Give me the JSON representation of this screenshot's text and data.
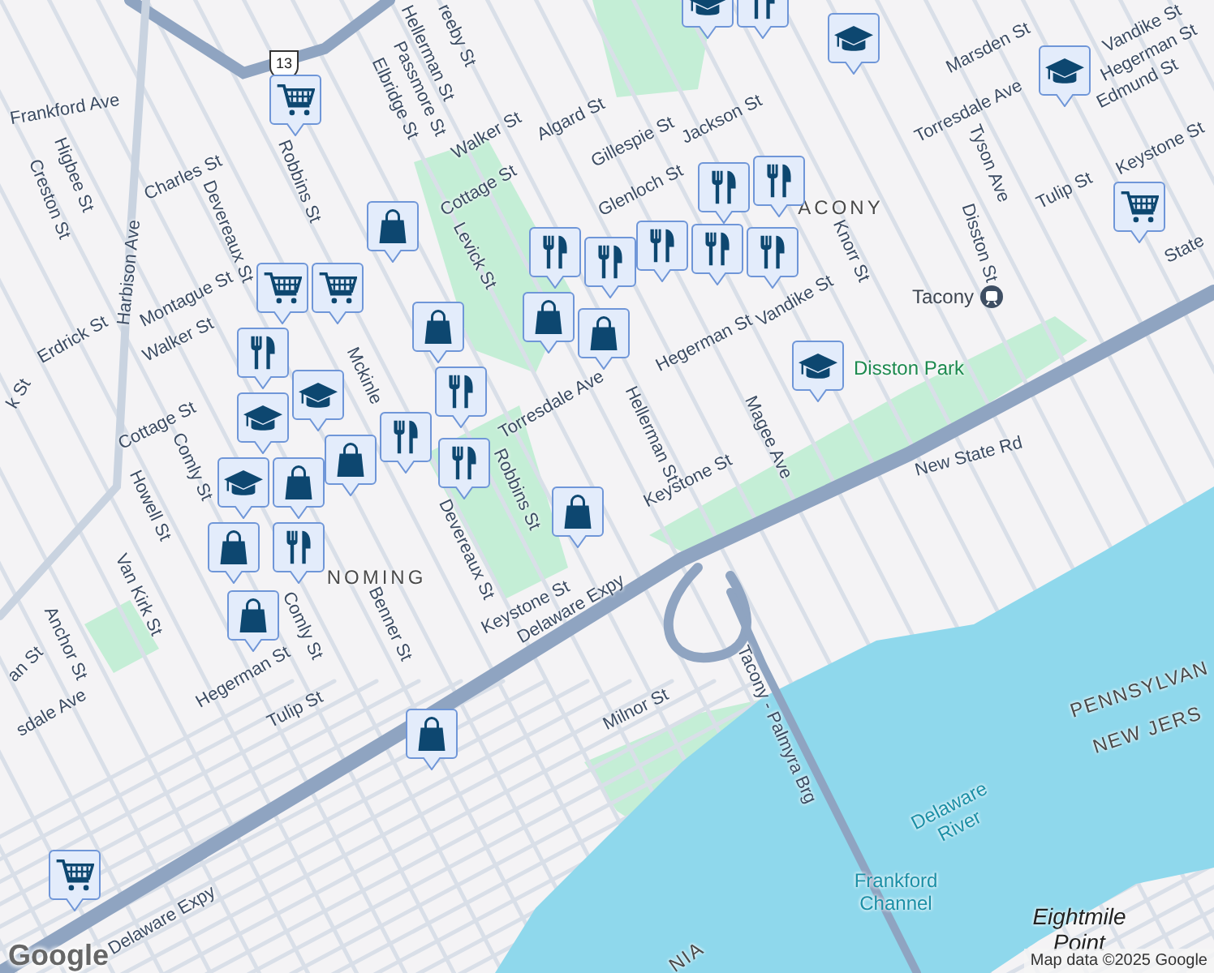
{
  "map": {
    "route_shield": "13",
    "labels": [
      {
        "text": "Frankford Ave",
        "kind": "street"
      },
      {
        "text": "Higbee St",
        "kind": "street"
      },
      {
        "text": "Creston St",
        "kind": "street"
      },
      {
        "text": "Charles St",
        "kind": "street"
      },
      {
        "text": "Harbison Ave",
        "kind": "street"
      },
      {
        "text": "Devereaux St",
        "kind": "street"
      },
      {
        "text": "Robbins St",
        "kind": "street"
      },
      {
        "text": "Erdrick St",
        "kind": "street"
      },
      {
        "text": "Montague St",
        "kind": "street"
      },
      {
        "text": "Walker St",
        "kind": "street"
      },
      {
        "text": "Cottage St",
        "kind": "street"
      },
      {
        "text": "Comly St",
        "kind": "street"
      },
      {
        "text": "Howell St",
        "kind": "street"
      },
      {
        "text": "Van Kirk St",
        "kind": "street"
      },
      {
        "text": "Anchor St",
        "kind": "street"
      },
      {
        "text": "Hegerman St",
        "kind": "street"
      },
      {
        "text": "Tulip St",
        "kind": "street"
      },
      {
        "text": "Comly St",
        "kind": "street"
      },
      {
        "text": "Benner St",
        "kind": "street"
      },
      {
        "text": "Devereaux St",
        "kind": "street"
      },
      {
        "text": "Keystone St",
        "kind": "street"
      },
      {
        "text": "Robbins St",
        "kind": "street"
      },
      {
        "text": "Delaware Expy",
        "kind": "street"
      },
      {
        "text": "Delaware Expy",
        "kind": "street"
      },
      {
        "text": "Milnor St",
        "kind": "street"
      },
      {
        "text": "Tacony - Palmyra Brg",
        "kind": "street"
      },
      {
        "text": "sdale Ave",
        "kind": "street"
      },
      {
        "text": "an St",
        "kind": "street"
      },
      {
        "text": "k St",
        "kind": "street"
      },
      {
        "text": "reeby St",
        "kind": "street"
      },
      {
        "text": "Hellerman St",
        "kind": "street"
      },
      {
        "text": "Passmore St",
        "kind": "street"
      },
      {
        "text": "Elbridge St",
        "kind": "street"
      },
      {
        "text": "Walker St",
        "kind": "street"
      },
      {
        "text": "Algard St",
        "kind": "street"
      },
      {
        "text": "Cottage St",
        "kind": "street"
      },
      {
        "text": "Levick St",
        "kind": "street"
      },
      {
        "text": "Mckinle",
        "kind": "street"
      },
      {
        "text": "Torresdale Ave",
        "kind": "street"
      },
      {
        "text": "Gillespie St",
        "kind": "street"
      },
      {
        "text": "Jackson St",
        "kind": "street"
      },
      {
        "text": "Glenloch St",
        "kind": "street"
      },
      {
        "text": "Vandike St",
        "kind": "street"
      },
      {
        "text": "Hegerman St",
        "kind": "street"
      },
      {
        "text": "Hellerman St",
        "kind": "street"
      },
      {
        "text": "Knorr St",
        "kind": "street"
      },
      {
        "text": "Magee Ave",
        "kind": "street"
      },
      {
        "text": "Keystone St",
        "kind": "street"
      },
      {
        "text": "Marsden St",
        "kind": "street"
      },
      {
        "text": "Torresdale Ave",
        "kind": "street"
      },
      {
        "text": "Tyson Ave",
        "kind": "street"
      },
      {
        "text": "Disston St",
        "kind": "street"
      },
      {
        "text": "Vandike St",
        "kind": "street"
      },
      {
        "text": "Hegerman St",
        "kind": "street"
      },
      {
        "text": "Edmund St",
        "kind": "street"
      },
      {
        "text": "Tulip St",
        "kind": "street"
      },
      {
        "text": "Keystone St",
        "kind": "street"
      },
      {
        "text": "New State Rd",
        "kind": "street"
      },
      {
        "text": "State",
        "kind": "street"
      },
      {
        "text": "ACONY",
        "kind": "area"
      },
      {
        "text": "NOMING",
        "kind": "area"
      },
      {
        "text": "Disston Park",
        "kind": "park"
      },
      {
        "text": "Delaware River",
        "kind": "water"
      },
      {
        "text": "Frankford Channel",
        "kind": "water"
      },
      {
        "text": "Eightmile Point",
        "kind": "place"
      },
      {
        "text": "PENNSYLVAN",
        "kind": "region"
      },
      {
        "text": "NEW JERS",
        "kind": "region"
      },
      {
        "text": "NIA",
        "kind": "region"
      }
    ],
    "station": {
      "name": "Tacony"
    },
    "pins": [
      {
        "kind": "school"
      },
      {
        "kind": "restaurant"
      },
      {
        "kind": "school"
      },
      {
        "kind": "school"
      },
      {
        "kind": "cart"
      },
      {
        "kind": "bag"
      },
      {
        "kind": "cart"
      },
      {
        "kind": "cart"
      },
      {
        "kind": "restaurant"
      },
      {
        "kind": "bag"
      },
      {
        "kind": "bag"
      },
      {
        "kind": "restaurant"
      },
      {
        "kind": "restaurant"
      },
      {
        "kind": "bag"
      },
      {
        "kind": "restaurant"
      },
      {
        "kind": "school"
      },
      {
        "kind": "school"
      },
      {
        "kind": "bag"
      },
      {
        "kind": "restaurant"
      },
      {
        "kind": "school"
      },
      {
        "kind": "bag"
      },
      {
        "kind": "restaurant"
      },
      {
        "kind": "restaurant"
      },
      {
        "kind": "bag"
      },
      {
        "kind": "bag"
      },
      {
        "kind": "bag"
      },
      {
        "kind": "restaurant"
      },
      {
        "kind": "restaurant"
      },
      {
        "kind": "restaurant"
      },
      {
        "kind": "restaurant"
      },
      {
        "kind": "restaurant"
      },
      {
        "kind": "school"
      },
      {
        "kind": "cart"
      },
      {
        "kind": "bag"
      },
      {
        "kind": "cart"
      }
    ],
    "logo": "Google",
    "attribution": "Map data ©2025 Google"
  }
}
